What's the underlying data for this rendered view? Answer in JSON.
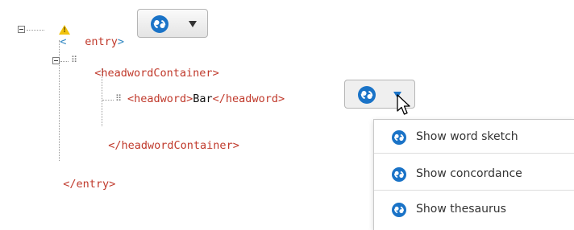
{
  "tree": {
    "entry_open": "<",
    "entry_name": "entry",
    "entry_close_bracket": ">",
    "entry_end": "</entry>",
    "headword_container_open": "<headwordContainer>",
    "headword_open": "<headword>",
    "headword_value": "Bar",
    "headword_close": "</headword>",
    "headword_container_close": "</headwordContainer>"
  },
  "icons": {
    "toggle": "collapse-toggle-icon",
    "grip": "drag-grip-icon",
    "warning": "warning-icon",
    "logo": "sketch-engine-logo-icon",
    "caret": "caret-down-icon",
    "cursor": "mouse-cursor-icon"
  },
  "warning_glyph": "!",
  "menu": {
    "items": [
      {
        "label": "Show word sketch"
      },
      {
        "label": "Show concordance"
      },
      {
        "label": "Show thesaurus"
      }
    ]
  },
  "colors": {
    "tag": "#c0392b",
    "logo": "#1a73c7",
    "warning": "#f1c40f"
  }
}
